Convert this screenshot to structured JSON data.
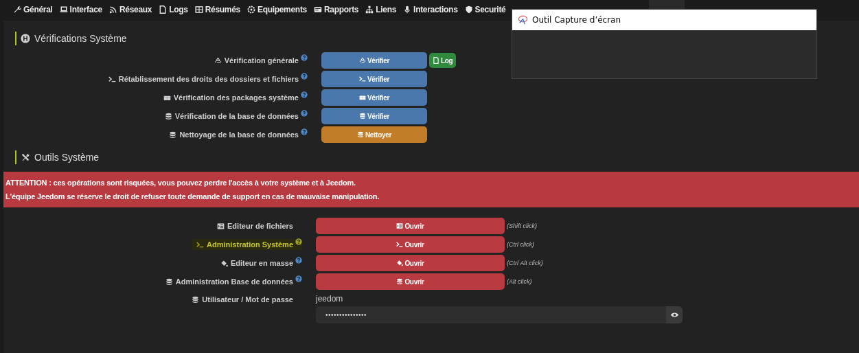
{
  "nav": {
    "items": [
      {
        "label": "Général",
        "selected": false
      },
      {
        "label": "Interface",
        "selected": false
      },
      {
        "label": "Réseaux",
        "selected": false
      },
      {
        "label": "Logs",
        "selected": false
      },
      {
        "label": "Résumés",
        "selected": false
      },
      {
        "label": "Equipements",
        "selected": false
      },
      {
        "label": "Rapports",
        "selected": false
      },
      {
        "label": "Liens",
        "selected": false
      },
      {
        "label": "Interactions",
        "selected": false
      },
      {
        "label": "Securité",
        "selected": false
      }
    ]
  },
  "verifications": {
    "title": "Vérifications Système",
    "rows": [
      {
        "label": "Vérification générale",
        "help": true,
        "button": "Vérifier",
        "kind": "primary",
        "extra_button": "Log"
      },
      {
        "label": "Rétablissement des droits des dossiers et fichiers",
        "help": true,
        "button": "Vérifier",
        "kind": "primary"
      },
      {
        "label": "Vérification des packages système",
        "help": true,
        "button": "Vérifier",
        "kind": "primary"
      },
      {
        "label": "Vérification de la base de données",
        "help": true,
        "button": "Vérifier",
        "kind": "primary"
      },
      {
        "label": "Nettoyage de la base de données",
        "help": true,
        "button": "Nettoyer",
        "kind": "warning"
      }
    ]
  },
  "tools": {
    "title": "Outils Système",
    "alert": [
      "ATTENTION : ces opérations sont risquées, vous pouvez perdre l'accès à votre système et à Jeedom.",
      "L'équipe Jeedom se réserve le droit de refuser toute demande de support en cas de mauvaise manipulation."
    ],
    "rows": [
      {
        "label": "Editeur de fichiers",
        "help": false,
        "highlighted": false,
        "button": "Ouvrir",
        "hint": "(Shift click)"
      },
      {
        "label": "Administration Système",
        "help": true,
        "highlighted": true,
        "button": "Ouvrir",
        "hint": "(Ctrl click)"
      },
      {
        "label": "Editeur en masse",
        "help": true,
        "highlighted": false,
        "button": "Ouvrir",
        "hint": "(Ctrl Alt click)"
      },
      {
        "label": "Administration Base de données",
        "help": true,
        "highlighted": false,
        "button": "Ouvrir",
        "hint": "(Alt click)"
      }
    ],
    "credentials": {
      "label": "Utilisateur / Mot de passe",
      "username": "jeedom",
      "password": "•••••••••••••••"
    }
  },
  "snipping_window": {
    "title": "Outil Capture d’écran"
  }
}
